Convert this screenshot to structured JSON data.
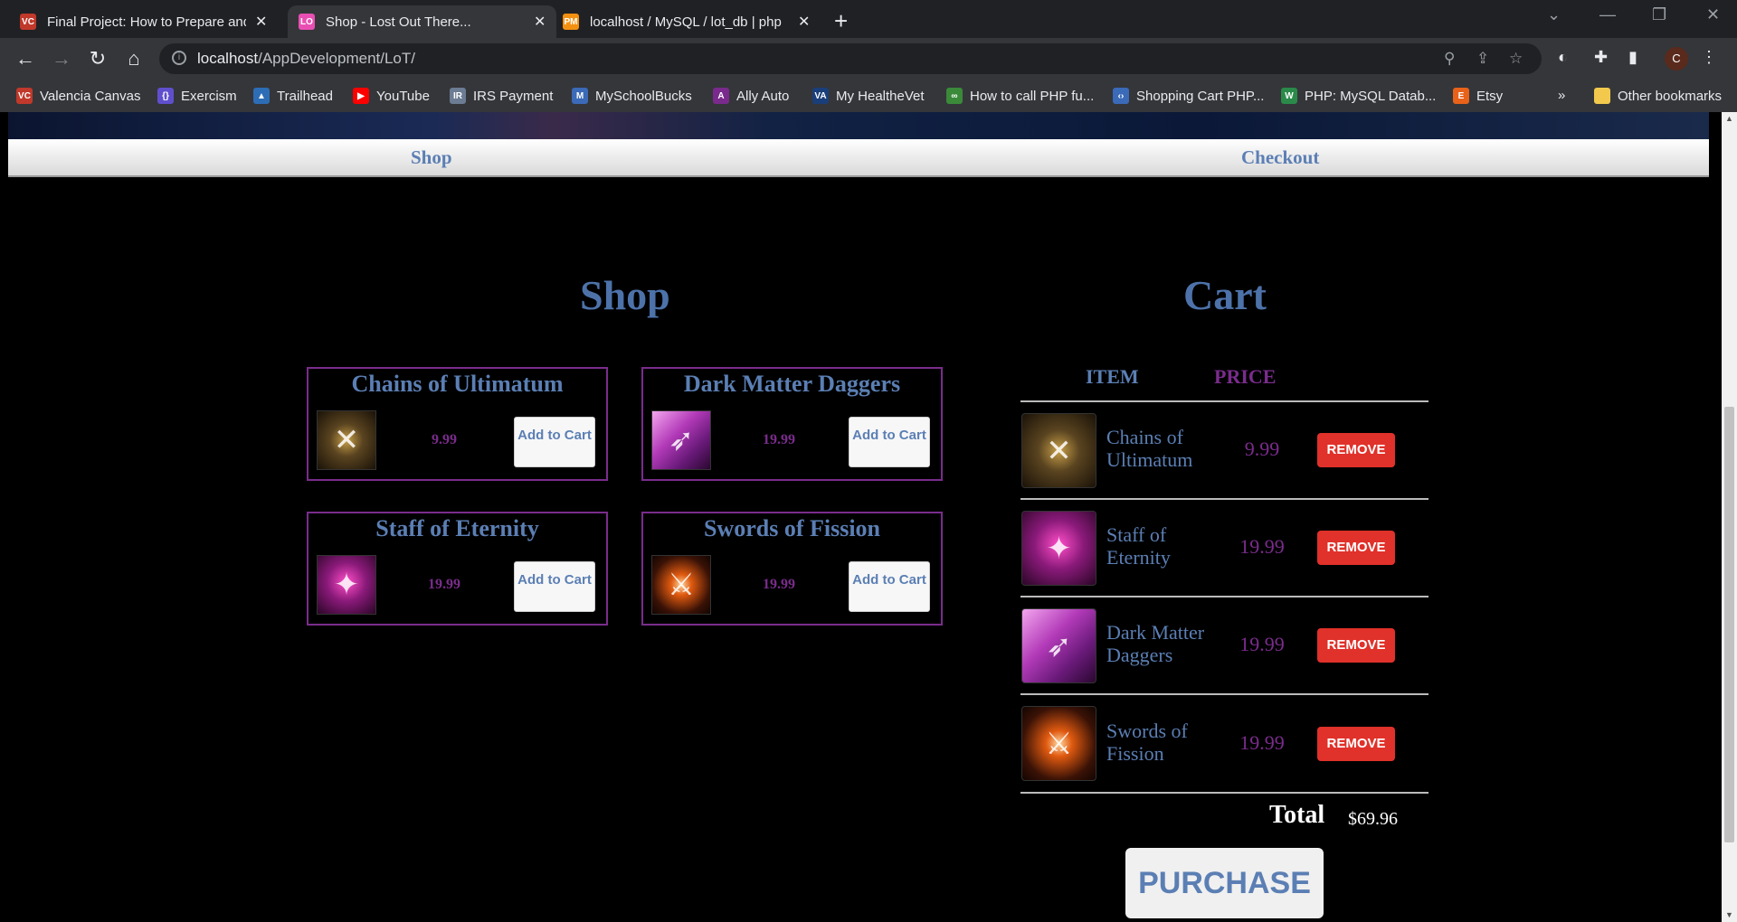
{
  "browser": {
    "tabs": [
      {
        "title": "Final Project: How to Prepare and",
        "favicon_text": "VC",
        "favicon_color": "#c0392b"
      },
      {
        "title": "Shop - Lost Out There...",
        "favicon_text": "LO",
        "favicon_color": "#e94fb3"
      },
      {
        "title": "localhost / MySQL / lot_db | php",
        "favicon_text": "PM",
        "favicon_color": "#f29111"
      }
    ],
    "url_host": "localhost",
    "url_path": "/AppDevelopment/LoT/",
    "profile_initial": "C",
    "bookmarks": [
      {
        "label": "Valencia Canvas",
        "icon_color": "#c0392b",
        "icon_text": "VC"
      },
      {
        "label": "Exercism",
        "icon_color": "#604fcd",
        "icon_text": "{}"
      },
      {
        "label": "Trailhead",
        "icon_color": "#2d6db5",
        "icon_text": "▲"
      },
      {
        "label": "YouTube",
        "icon_color": "#ff0000",
        "icon_text": "▶"
      },
      {
        "label": "IRS Payment",
        "icon_color": "#6b7c93",
        "icon_text": "IR"
      },
      {
        "label": "MySchoolBucks",
        "icon_color": "#3a6ab8",
        "icon_text": "M"
      },
      {
        "label": "Ally Auto",
        "icon_color": "#7a2a8c",
        "icon_text": "A"
      },
      {
        "label": "My HealtheVet",
        "icon_color": "#1a3e7a",
        "icon_text": "VA"
      },
      {
        "label": "How to call PHP fu...",
        "icon_color": "#3a8a3a",
        "icon_text": "∞"
      },
      {
        "label": "Shopping Cart PHP...",
        "icon_color": "#3a6ab8",
        "icon_text": "‹›"
      },
      {
        "label": "PHP: MySQL Datab...",
        "icon_color": "#2a8a4a",
        "icon_text": "W"
      },
      {
        "label": "Etsy",
        "icon_color": "#e8621a",
        "icon_text": "E"
      }
    ],
    "bookmarks_overflow": "»",
    "other_bookmarks": "Other bookmarks"
  },
  "site_nav": {
    "shop": "Shop",
    "checkout": "Checkout"
  },
  "shop": {
    "heading": "Shop",
    "items": [
      {
        "name": "Chains of Ultimatum",
        "price": "9.99",
        "button": "Add to Cart",
        "image": "chains-icon"
      },
      {
        "name": "Dark Matter Daggers",
        "price": "19.99",
        "button": "Add to Cart",
        "image": "daggers-icon"
      },
      {
        "name": "Staff of Eternity",
        "price": "19.99",
        "button": "Add to Cart",
        "image": "staff-icon"
      },
      {
        "name": "Swords of Fission",
        "price": "19.99",
        "button": "Add to Cart",
        "image": "swords-icon"
      }
    ]
  },
  "cart": {
    "heading": "Cart",
    "col_item": "ITEM",
    "col_price": "PRICE",
    "rows": [
      {
        "name": "Chains of Ultimatum",
        "price": "9.99",
        "remove": "REMOVE",
        "image": "chains-icon"
      },
      {
        "name": "Staff of Eternity",
        "price": "19.99",
        "remove": "REMOVE",
        "image": "staff-icon"
      },
      {
        "name": "Dark Matter Daggers",
        "price": "19.99",
        "remove": "REMOVE",
        "image": "daggers-icon"
      },
      {
        "name": "Swords of Fission",
        "price": "19.99",
        "remove": "REMOVE",
        "image": "swords-icon"
      }
    ],
    "total_label": "Total",
    "total_value": "$69.96",
    "purchase": "PURCHASE"
  },
  "colors": {
    "accent_blue": "#5b7fb4",
    "accent_purple": "#7a2c8c",
    "remove_red": "#e0312a"
  }
}
